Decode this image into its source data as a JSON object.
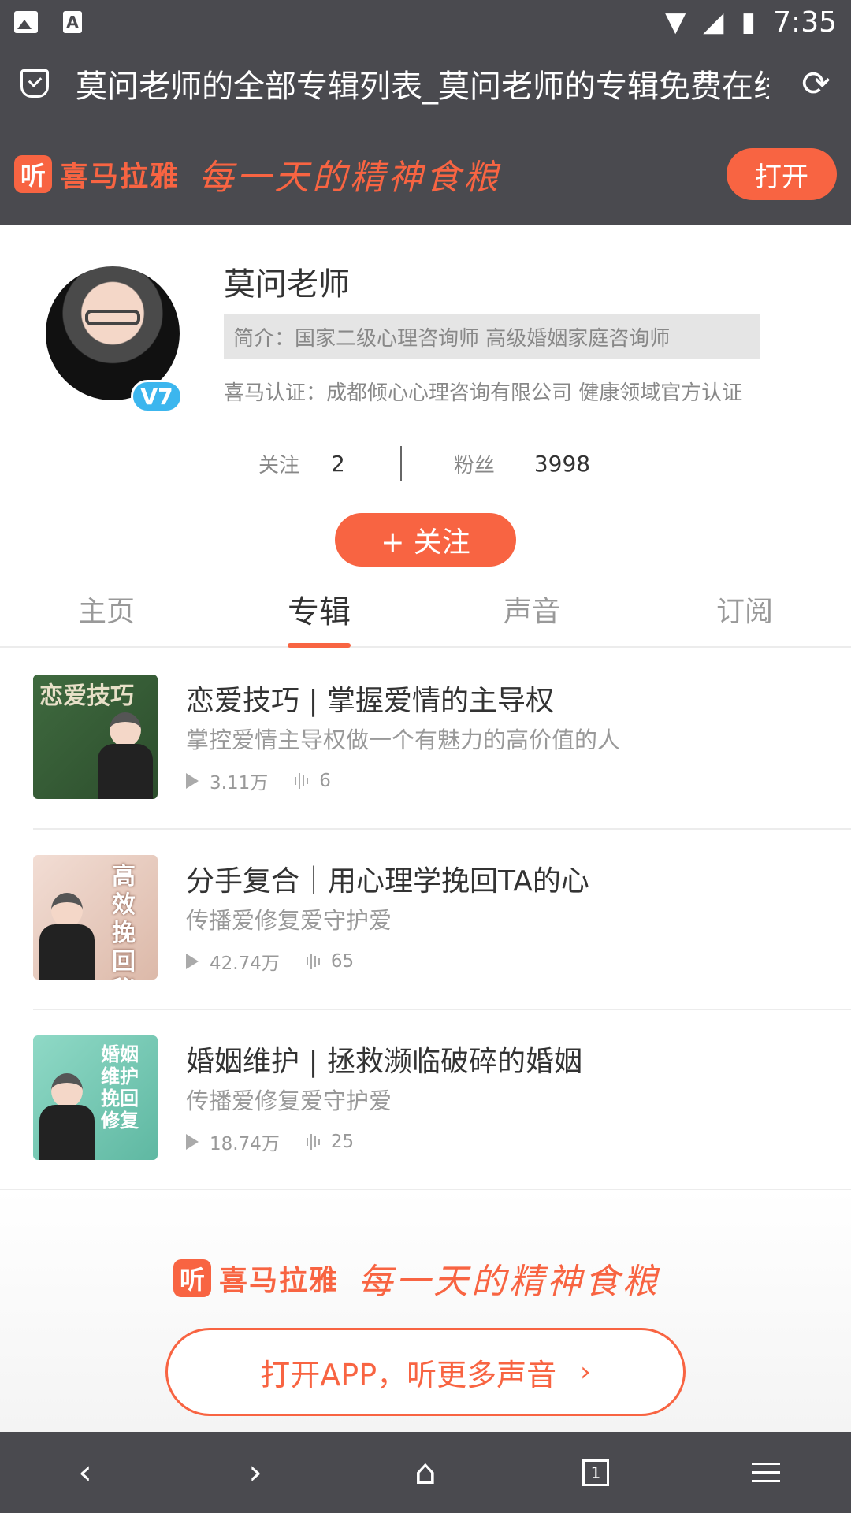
{
  "status_bar": {
    "time": "7:35"
  },
  "url_bar": {
    "title": "莫问老师的全部专辑列表_莫问老师的专辑免费在线收听"
  },
  "banner": {
    "brand": "喜马拉雅",
    "logo_char": "听",
    "slogan": "每一天的精神食粮",
    "open_label": "打开"
  },
  "profile": {
    "name": "莫问老师",
    "level": "V7",
    "intro": "简介：国家二级心理咨询师 高级婚姻家庭咨询师",
    "cert": "喜马认证：成都倾心心理咨询有限公司 健康领域官方认证",
    "following_label": "关注",
    "following_count": "2",
    "fans_label": "粉丝",
    "fans_count": "3998",
    "follow_button": "+ 关注"
  },
  "tabs": [
    {
      "label": "主页"
    },
    {
      "label": "专辑"
    },
    {
      "label": "声音"
    },
    {
      "label": "订阅"
    }
  ],
  "albums": [
    {
      "title": "恋爱技巧 | 掌握爱情的主导权",
      "desc": "掌控爱情主导权做一个有魅力的高价值的人",
      "plays": "3.11万",
      "tracks": "6",
      "cover_text": "恋爱技巧"
    },
    {
      "title": "分手复合｜用心理学挽回TA的心",
      "desc": "传播爱修复爱守护爱",
      "plays": "42.74万",
      "tracks": "65",
      "cover_text": "高效挽回秘籍"
    },
    {
      "title": "婚姻维护 | 拯救濒临破碎的婚姻",
      "desc": "传播爱修复爱守护爱",
      "plays": "18.74万",
      "tracks": "25",
      "cover_text": "婚姻维护挽回修复"
    }
  ],
  "footer": {
    "brand": "喜马拉雅",
    "logo_char": "听",
    "slogan": "每一天的精神食粮",
    "open_app": "打开APP，听更多声音"
  },
  "nav": {
    "tab_count": "1"
  },
  "colors": {
    "accent": "#f86442",
    "bar": "#4a4a4f",
    "badge": "#3cb6ee"
  }
}
